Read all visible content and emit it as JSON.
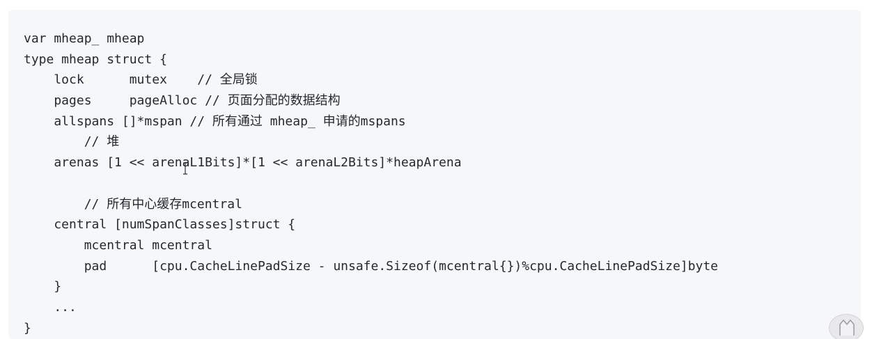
{
  "code_lines": [
    "var mheap_ mheap",
    "type mheap struct {",
    "    lock      mutex    // 全局锁",
    "    pages     pageAlloc // 页面分配的数据结构",
    "    allspans []*mspan // 所有通过 mheap_ 申请的mspans",
    "        // 堆",
    "    arenas [1 << arenaL1Bits]*[1 << arenaL2Bits]*heapArena",
    "",
    "        // 所有中心缓存mcentral",
    "    central [numSpanClasses]struct {",
    "        mcentral mcentral",
    "        pad      [cpu.CacheLinePadSize - unsafe.Sizeof(mcentral{})%cpu.CacheLinePadSize]byte",
    "    }",
    "    ...",
    "}"
  ],
  "cursor_icon": "text-cursor-icon",
  "corner_icon": "mascot-icon",
  "colors": {
    "code_background": "#f6f7f9",
    "code_text": "#24292f"
  }
}
